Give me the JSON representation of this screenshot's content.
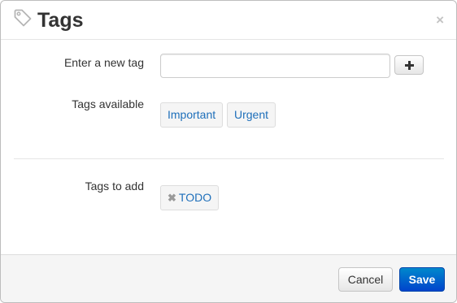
{
  "header": {
    "title": "Tags",
    "icon": "tag-icon",
    "close_label": "×"
  },
  "form": {
    "new_tag_label": "Enter a new tag",
    "new_tag_value": "",
    "new_tag_placeholder": "",
    "add_button_icon": "plus-icon",
    "available_label": "Tags available",
    "available_tags": [
      "Important",
      "Urgent"
    ],
    "to_add_label": "Tags to add",
    "to_add_tags": [
      "TODO"
    ],
    "remove_icon_glyph": "✖"
  },
  "footer": {
    "cancel_label": "Cancel",
    "save_label": "Save"
  },
  "colors": {
    "link": "#1e6fba",
    "primary_button": "#0055cc",
    "footer_bg": "#f5f5f5"
  }
}
